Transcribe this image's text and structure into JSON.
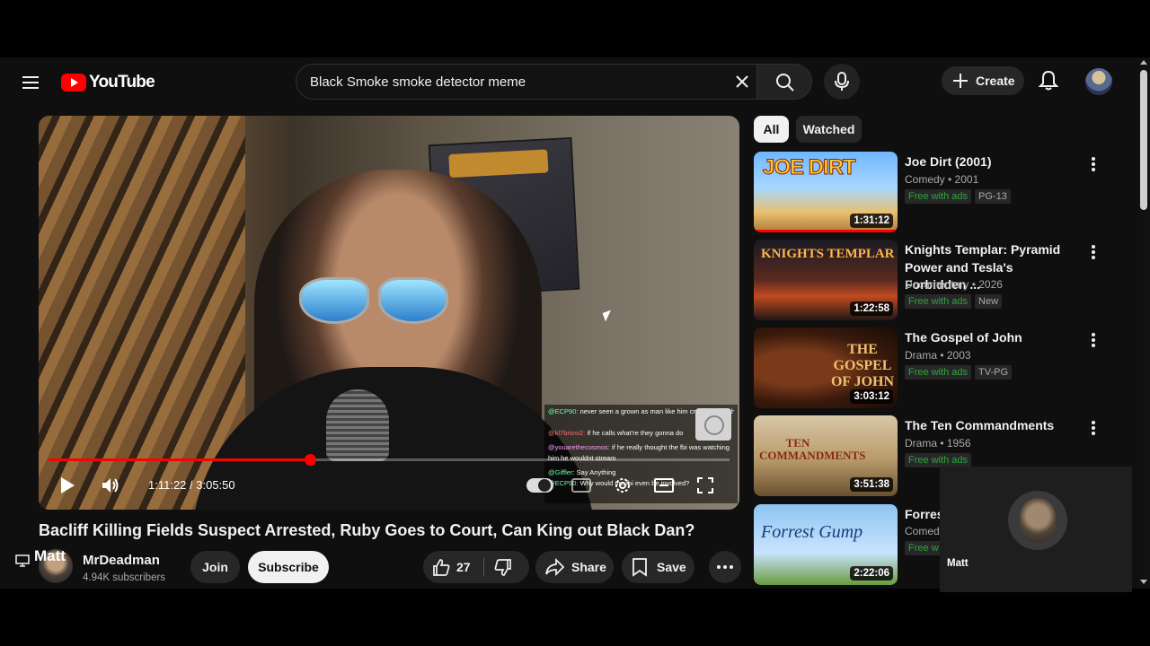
{
  "header": {
    "logo_text": "YouTube",
    "search_value": "Black Smoke smoke detector meme",
    "create_label": "Create"
  },
  "player": {
    "time_current": "1:11:22",
    "time_total": "3:05:50",
    "time_display": "1:11:22 / 3:05:50",
    "progress_fraction": 0.384,
    "chat": [
      {
        "user": "@ECP90:",
        "msg": "never seen a grown as man like him crying as much as he does too"
      },
      {
        "user": "@kl7briosi2:",
        "msg": "if he calls what're they gonna do"
      },
      {
        "user": "@youarethecosmos:",
        "msg": "if he really thought the fbi was watching him he wouldnt stream"
      },
      {
        "user": "@Giffler:",
        "msg": "Say Anything"
      },
      {
        "user": "@ECP90:",
        "msg": "Why would the fbi even be involved?"
      }
    ]
  },
  "video": {
    "title": "Bacliff Killing Fields Suspect Arrested, Ruby Goes to Court, Can King out Black Dan?",
    "channel": "MrDeadman",
    "overlay_name": "Matt",
    "subscribers": "4.94K subscribers",
    "join_label": "Join",
    "subscribe_label": "Subscribe",
    "likes": "27",
    "share_label": "Share",
    "save_label": "Save"
  },
  "sidebar": {
    "chips": [
      "All",
      "Watched"
    ],
    "items": [
      {
        "title": "Joe Dirt (2001)",
        "sub": "Comedy • 2001",
        "badges": [
          "Free with ads",
          "PG-13"
        ],
        "duration": "1:31:12",
        "thumb_text": "JOE DIRT",
        "watched": true
      },
      {
        "title": "Knights Templar: Pyramid Power and Tesla's Forbidden ...",
        "sub": "Documentary • 2026",
        "badges": [
          "Free with ads",
          "New"
        ],
        "duration": "1:22:58",
        "thumb_text": "KNIGHTS TEMPLAR"
      },
      {
        "title": "The Gospel of John",
        "sub": "Drama • 2003",
        "badges": [
          "Free with ads",
          "TV-PG"
        ],
        "duration": "3:03:12",
        "thumb_text": "THE GOSPEL OF JOHN"
      },
      {
        "title": "The Ten Commandments",
        "sub": "Drama • 1956",
        "badges": [
          "Free with ads"
        ],
        "duration": "3:51:38",
        "thumb_text": "TEN COMMANDMENTS"
      },
      {
        "title": "Forrest Gump",
        "sub": "Comedy",
        "badges": [
          "Free w"
        ],
        "duration": "2:22:06",
        "thumb_text": "Forrest Gump"
      }
    ]
  },
  "floating": {
    "name": "Matt"
  },
  "colors": {
    "accent": "#ff0000",
    "background": "#0f0f0f",
    "chip_active": "#f1f1f1",
    "free_badge": "#2ba640"
  },
  "icons": [
    "menu-icon",
    "youtube-logo-icon",
    "close-icon",
    "search-icon",
    "mic-icon",
    "plus-icon",
    "bell-icon",
    "play-icon",
    "volume-icon",
    "settings-icon",
    "fullscreen-icon",
    "theater-icon",
    "captions-icon",
    "like-icon",
    "dislike-icon",
    "share-icon",
    "save-icon",
    "more-icon",
    "kebab-icon",
    "tv-icon"
  ]
}
